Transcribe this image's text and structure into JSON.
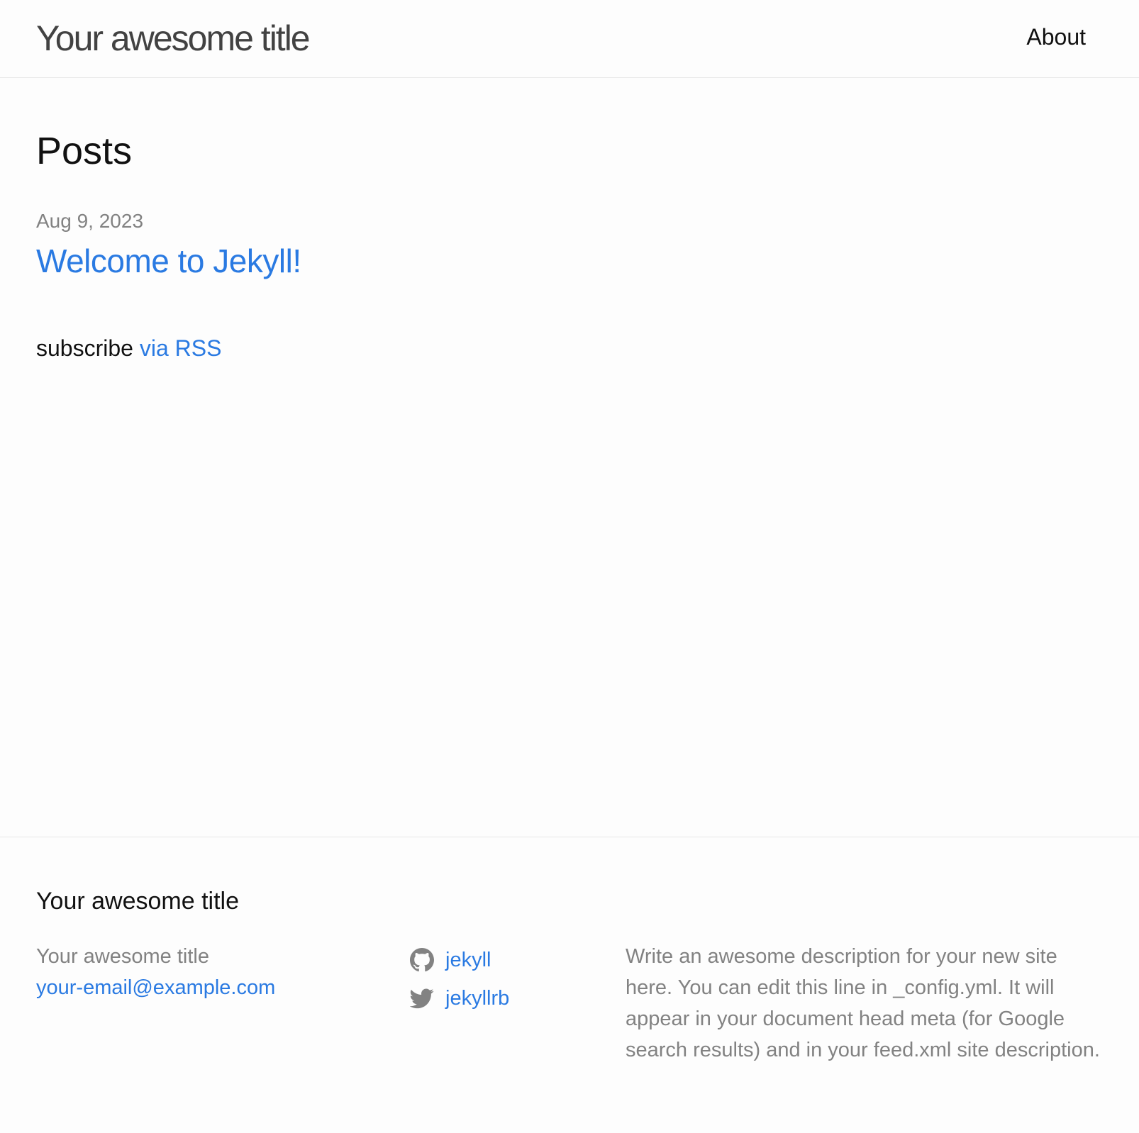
{
  "header": {
    "site_title": "Your awesome title",
    "nav": {
      "about_label": "About"
    }
  },
  "main": {
    "page_heading": "Posts",
    "posts": [
      {
        "date": "Aug 9, 2023",
        "title": "Welcome to Jekyll!"
      }
    ],
    "rss": {
      "prefix": "subscribe",
      "link_label": "via RSS"
    }
  },
  "footer": {
    "heading": "Your awesome title",
    "contact": {
      "name": "Your awesome title",
      "email": "your-email@example.com"
    },
    "social": [
      {
        "icon": "github-icon",
        "label": "jekyll"
      },
      {
        "icon": "twitter-icon",
        "label": "jekyllrb"
      }
    ],
    "description": "Write an awesome description for your new site here. You can edit this line in _config.yml. It will appear in your document head meta (for Google search results) and in your feed.xml site description."
  },
  "colors": {
    "link": "#2a7ae2",
    "muted": "#828282",
    "text": "#111111",
    "border": "#e8e8e8",
    "background": "#fdfdfd"
  }
}
